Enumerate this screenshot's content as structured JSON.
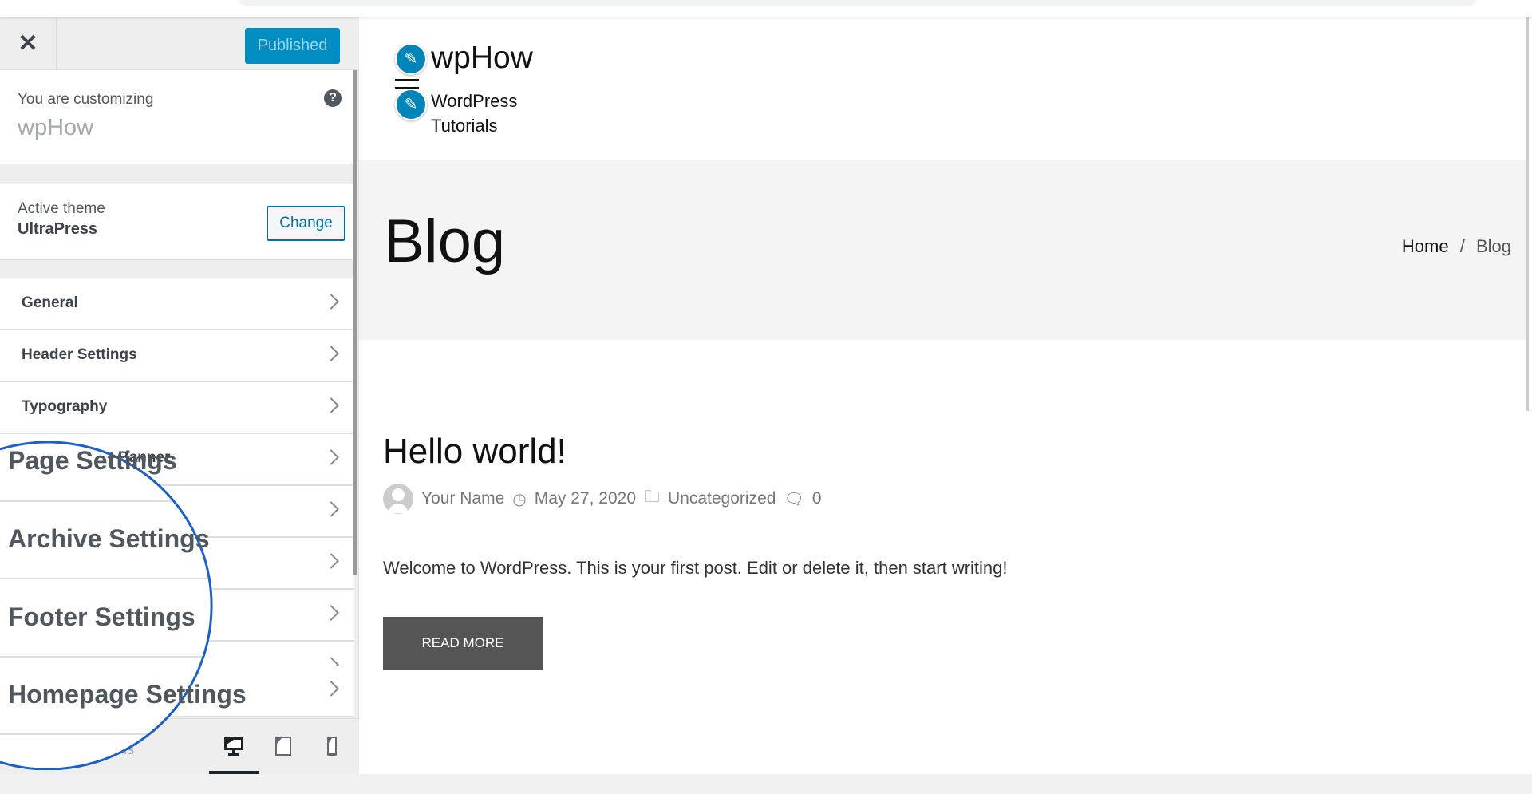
{
  "browser": {
    "address_bar": ""
  },
  "sidebar": {
    "close_icon": "close-icon",
    "publish_label": "Published",
    "customizing_label": "You are customizing",
    "site_name": "wpHow",
    "help_icon": "?",
    "active_theme_label": "Active theme",
    "active_theme_name": "UltraPress",
    "change_label": "Change",
    "items": [
      {
        "label": "General"
      },
      {
        "label": "Header Settings"
      },
      {
        "label": "Typography"
      },
      {
        "label": "Banner"
      }
    ],
    "magnified_items": [
      "Page Settings",
      "Archive Settings",
      "Footer Settings",
      "Homepage Settings"
    ],
    "footer": {
      "hide_controls_label": "ols",
      "devices": [
        "desktop",
        "tablet",
        "mobile"
      ],
      "active_device": "desktop"
    },
    "accent": "#008ec2",
    "magnifier_color": "#1c5fc6"
  },
  "preview": {
    "site_title": "wpHow",
    "tagline": "WordPress Tutorials",
    "page_title": "Blog",
    "breadcrumb": {
      "home": "Home",
      "sep": "/",
      "current": "Blog"
    },
    "post": {
      "title": "Hello world!",
      "author": "Your Name",
      "date": "May 27, 2020",
      "category": "Uncategorized",
      "comments": "0",
      "excerpt": "Welcome to WordPress. This is your first post. Edit or delete it, then start writing!",
      "read_more": "READ MORE"
    }
  }
}
